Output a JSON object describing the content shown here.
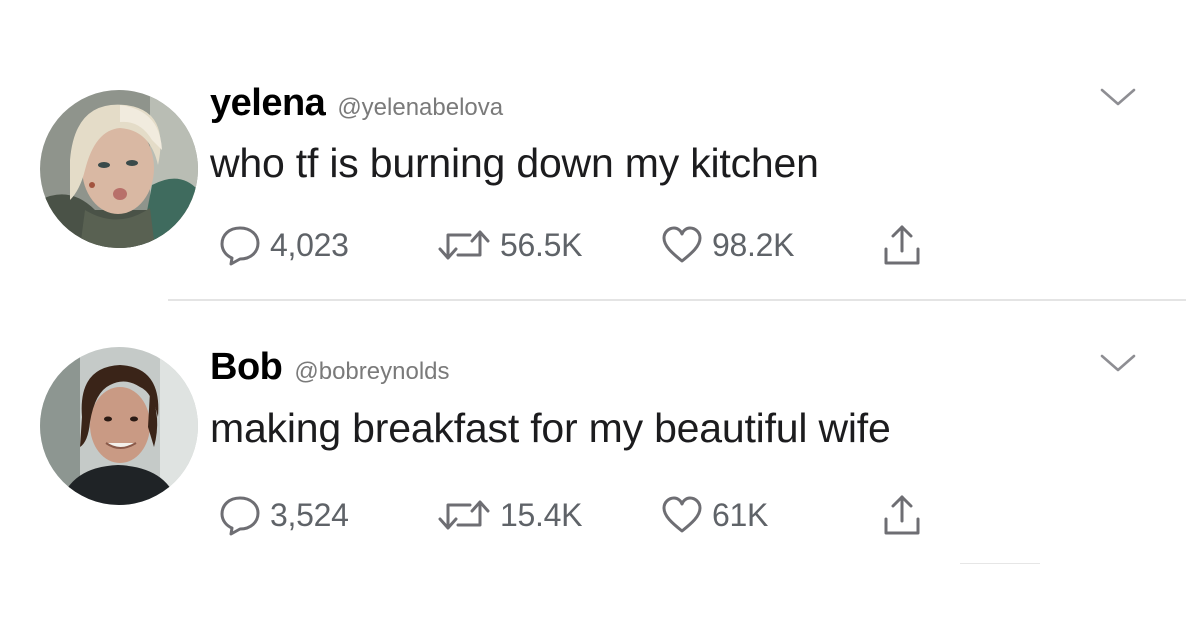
{
  "tweets": [
    {
      "display_name": "yelena",
      "handle": "@yelenabelova",
      "text": "who tf is burning down my kitchen",
      "replies": "4,023",
      "retweets": "56.5K",
      "likes": "98.2K"
    },
    {
      "display_name": "Bob",
      "handle": "@bobreynolds",
      "text": "making breakfast for my beautiful wife",
      "replies": "3,524",
      "retweets": "15.4K",
      "likes": "61K"
    }
  ],
  "icons": {
    "reply": "speech-bubble-icon",
    "retweet": "retweet-arrows-icon",
    "like": "heart-icon",
    "share": "share-upload-icon",
    "more": "chevron-down-icon"
  },
  "colors": {
    "icon_gray": "#6e6e73",
    "divider": "#e4e4e4",
    "handle_gray": "#7a7a7a"
  }
}
